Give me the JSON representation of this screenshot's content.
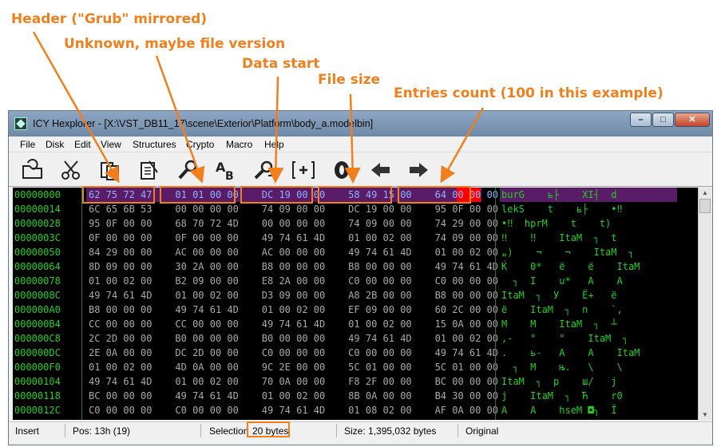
{
  "annotations": {
    "header": "Header (\"Grub\" mirrored)",
    "unknown": "Unknown, maybe file version",
    "data_start": "Data start",
    "file_size": "File size",
    "entries_count": "Entries count (100 in this example)"
  },
  "window": {
    "title": "ICY Hexplorer - [X:\\VST_DB11_17\\scene\\Exterior\\Platform\\body_a.modelbin]",
    "minimize": "–",
    "maximize": "□",
    "close": "✕"
  },
  "menu": [
    "File",
    "Disk",
    "Edit",
    "View",
    "Structures",
    "Crypto",
    "Macro",
    "Help"
  ],
  "toolbar": [
    {
      "name": "open-file-icon",
      "glyph": "📂"
    },
    {
      "name": "cut-icon",
      "glyph": "✂"
    },
    {
      "name": "copy-icon",
      "glyph": "📋"
    },
    {
      "name": "paste-icon",
      "glyph": "📄"
    },
    {
      "name": "find-icon",
      "glyph": "🔎"
    },
    {
      "name": "replace-icon",
      "glyph": "A→B"
    },
    {
      "name": "find-next-icon",
      "glyph": "🔍"
    },
    {
      "name": "goto-offset-icon",
      "glyph": "[+]"
    },
    {
      "name": "goto-start-icon",
      "glyph": "0"
    },
    {
      "name": "back-arrow-icon",
      "glyph": "⬅"
    },
    {
      "name": "forward-arrow-icon",
      "glyph": "➡"
    }
  ],
  "hex": {
    "addresses": [
      "00000000",
      "00000014",
      "00000028",
      "0000003C",
      "00000050",
      "00000064",
      "00000078",
      "0000008C",
      "000000A0",
      "000000B4",
      "000000C8",
      "000000DC",
      "000000F0",
      "00000104",
      "00000118",
      "0000012C"
    ],
    "groups": [
      [
        "62 75 72 47",
        "01 01 00 00",
        "DC 19 00 00",
        "58 49 15 00",
        "64 00 00 00"
      ],
      [
        "6C 65 6B 53",
        "00 00 00 00",
        "74 09 00 00",
        "DC 19 00 00",
        "95 0F 00 00"
      ],
      [
        "95 0F 00 00",
        "68 70 72 4D",
        "00 00 00 00",
        "74 09 00 00",
        "74 29 00 00"
      ],
      [
        "0F 00 00 00",
        "0F 00 00 00",
        "49 74 61 4D",
        "01 00 02 00",
        "74 09 00 00"
      ],
      [
        "84 29 00 00",
        "AC 00 00 00",
        "AC 00 00 00",
        "49 74 61 4D",
        "01 00 02 00"
      ],
      [
        "8D 09 00 00",
        "30 2A 00 00",
        "B8 00 00 00",
        "B8 00 00 00",
        "49 74 61 4D"
      ],
      [
        "01 00 02 00",
        "B2 09 00 00",
        "E8 2A 00 00",
        "C0 00 00 00",
        "C0 00 00 00"
      ],
      [
        "49 74 61 4D",
        "01 00 02 00",
        "D3 09 00 00",
        "A8 2B 00 00",
        "B8 00 00 00"
      ],
      [
        "B8 00 00 00",
        "49 74 61 4D",
        "01 00 02 00",
        "EF 09 00 00",
        "60 2C 00 00"
      ],
      [
        "CC 00 00 00",
        "CC 00 00 00",
        "49 74 61 4D",
        "01 00 02 00",
        "15 0A 00 00"
      ],
      [
        "2C 2D 00 00",
        "B0 00 00 00",
        "B0 00 00 00",
        "49 74 61 4D",
        "01 00 02 00"
      ],
      [
        "2E 0A 00 00",
        "DC 2D 00 00",
        "C0 00 00 00",
        "C0 00 00 00",
        "49 74 61 4D"
      ],
      [
        "01 00 02 00",
        "4D 0A 00 00",
        "9C 2E 00 00",
        "5C 01 00 00",
        "5C 01 00 00"
      ],
      [
        "49 74 61 4D",
        "01 00 02 00",
        "70 0A 00 00",
        "F8 2F 00 00",
        "BC 00 00 00"
      ],
      [
        "BC 00 00 00",
        "49 74 61 4D",
        "01 00 02 00",
        "8B 0A 00 00",
        "B4 30 00 00"
      ],
      [
        "C0 00 00 00",
        "C0 00 00 00",
        "49 74 61 4D",
        "01 08 02 00",
        "AF 0A 00 00"
      ]
    ],
    "ascii": [
      "burG    ь├    XI┤  d",
      "lekS    t    ь├    •‼",
      "•‼  hprM    t    t)",
      "‼    ‼    ItaM  ┐  t",
      "„)    ¬    ¬    ItaM  ┐",
      "Ќ    0*   ё    ё    ItaM",
      "  ┐  I    u*   А    А",
      "ItaM  ┐  У    Ё+   ё",
      "ё    ItaM  ┐  n    `,",
      "M    M    ItaM  ┐  ┴",
      ",-   °    °    ItaM  ┐",
      ".    ь-   А    А    ItaM",
      "  ┐  M    њ.   \\    \\",
      "ItaM  ┐  p    ш/   j",
      "j    ItaM  ┐  Ћ    r0",
      "А    А    hseM ◘┐  Ї"
    ]
  },
  "status": {
    "mode": "Insert",
    "position": "Pos: 13h (19)",
    "selection_label": "Selection",
    "selection_value": "20 bytes",
    "size": "Size: 1,395,032 bytes",
    "state": "Original"
  },
  "colors": {
    "annotation": "#f07f1c",
    "hex_text": "#1fd11f",
    "row_highlight": "#5a1c66",
    "cursor_red": "#ff0000"
  }
}
